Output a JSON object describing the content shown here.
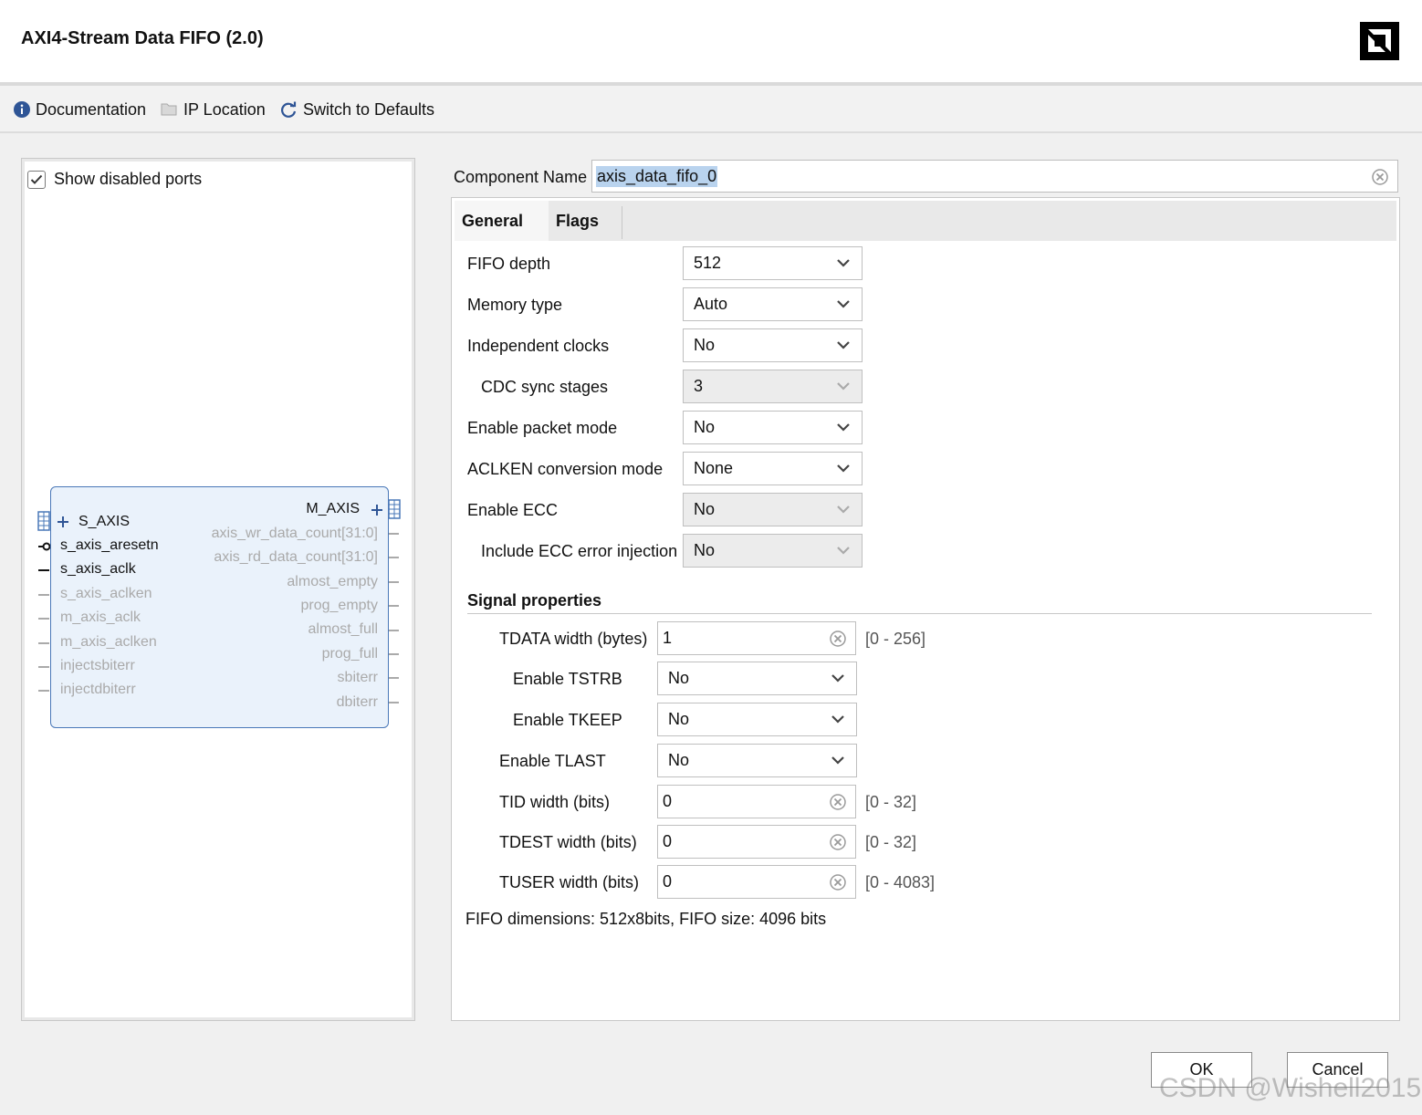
{
  "window": {
    "title": "AXI4-Stream Data FIFO (2.0)",
    "logo_icon": "amd-logo-icon"
  },
  "toolbar": {
    "documentation": "Documentation",
    "ip_location": "IP Location",
    "switch_defaults": "Switch to Defaults"
  },
  "left": {
    "show_disabled_ports": "Show disabled ports",
    "show_disabled_checked": true,
    "block": {
      "left_ports": [
        {
          "label": "S_AXIS",
          "enabled": true
        },
        {
          "label": "s_axis_aresetn",
          "enabled": true
        },
        {
          "label": "s_axis_aclk",
          "enabled": true
        },
        {
          "label": "s_axis_aclken",
          "enabled": false
        },
        {
          "label": "m_axis_aclk",
          "enabled": false
        },
        {
          "label": "m_axis_aclken",
          "enabled": false
        },
        {
          "label": "injectsbiterr",
          "enabled": false
        },
        {
          "label": "injectdbiterr",
          "enabled": false
        }
      ],
      "right_ports": [
        {
          "label": "M_AXIS",
          "enabled": true
        },
        {
          "label": "axis_wr_data_count[31:0]",
          "enabled": false
        },
        {
          "label": "axis_rd_data_count[31:0]",
          "enabled": false
        },
        {
          "label": "almost_empty",
          "enabled": false
        },
        {
          "label": "prog_empty",
          "enabled": false
        },
        {
          "label": "almost_full",
          "enabled": false
        },
        {
          "label": "prog_full",
          "enabled": false
        },
        {
          "label": "sbiterr",
          "enabled": false
        },
        {
          "label": "dbiterr",
          "enabled": false
        }
      ]
    }
  },
  "component": {
    "label": "Component Name",
    "value": "axis_data_fifo_0"
  },
  "tabs": [
    {
      "label": "General",
      "active": true
    },
    {
      "label": "Flags",
      "active": false
    }
  ],
  "general": {
    "fields": [
      {
        "label": "FIFO depth",
        "value": "512",
        "enabled": true
      },
      {
        "label": "Memory type",
        "value": "Auto",
        "enabled": true
      },
      {
        "label": "Independent clocks",
        "value": "No",
        "enabled": true
      },
      {
        "label": "CDC sync stages",
        "value": "3",
        "enabled": false
      },
      {
        "label": "Enable packet mode",
        "value": "No",
        "enabled": true
      },
      {
        "label": "ACLKEN conversion mode",
        "value": "None",
        "enabled": true
      },
      {
        "label": "Enable ECC",
        "value": "No",
        "enabled": false
      },
      {
        "label": "Include ECC error injection",
        "value": "No",
        "enabled": false
      }
    ],
    "signal_properties": {
      "title": "Signal properties",
      "tdata": {
        "label": "TDATA width (bytes)",
        "value": "1",
        "range": "[0 - 256]"
      },
      "tstrb": {
        "label": "Enable TSTRB",
        "value": "No"
      },
      "tkeep": {
        "label": "Enable TKEEP",
        "value": "No"
      },
      "tlast": {
        "label": "Enable TLAST",
        "value": "No"
      },
      "tid": {
        "label": "TID width (bits)",
        "value": "0",
        "range": "[0 - 32]"
      },
      "tdest": {
        "label": "TDEST width (bits)",
        "value": "0",
        "range": "[0 - 32]"
      },
      "tuser": {
        "label": "TUSER width (bits)",
        "value": "0",
        "range": "[0 - 4083]"
      }
    },
    "dimensions": "FIFO dimensions: 512x8bits, FIFO size: 4096 bits"
  },
  "buttons": {
    "ok": "OK",
    "cancel": "Cancel"
  },
  "watermark": "CSDN @Wishell2015"
}
